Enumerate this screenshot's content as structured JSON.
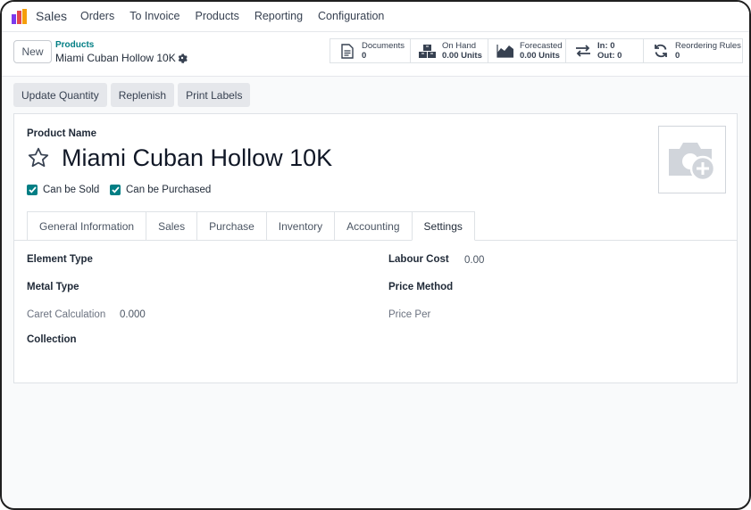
{
  "app": {
    "name": "Sales"
  },
  "menu": [
    {
      "label": "Orders"
    },
    {
      "label": "To Invoice"
    },
    {
      "label": "Products"
    },
    {
      "label": "Reporting"
    },
    {
      "label": "Configuration"
    }
  ],
  "control": {
    "new_label": "New",
    "breadcrumb_parent": "Products",
    "breadcrumb_current": "Miami Cuban Hollow 10K"
  },
  "smart_buttons": {
    "documents": {
      "label": "Documents",
      "value": "0",
      "icon": "document-icon"
    },
    "on_hand": {
      "label": "On Hand",
      "value": "0.00 Units",
      "icon": "boxes-icon"
    },
    "forecasted": {
      "label": "Forecasted",
      "value": "0.00 Units",
      "icon": "area-chart-icon"
    },
    "in_out": {
      "in_label": "In: 0",
      "out_label": "Out: 0",
      "icon": "transfer-arrows-icon"
    },
    "reordering": {
      "label": "Reordering Rules",
      "value": "0",
      "icon": "refresh-icon"
    }
  },
  "actions": {
    "update_quantity": "Update Quantity",
    "replenish": "Replenish",
    "print_labels": "Print Labels"
  },
  "form": {
    "product_name_label": "Product Name",
    "product_name": "Miami Cuban Hollow 10K",
    "can_be_sold": {
      "label": "Can be Sold",
      "checked": true
    },
    "can_be_purchased": {
      "label": "Can be Purchased",
      "checked": true
    }
  },
  "tabs": [
    {
      "label": "General Information"
    },
    {
      "label": "Sales"
    },
    {
      "label": "Purchase"
    },
    {
      "label": "Inventory"
    },
    {
      "label": "Accounting"
    },
    {
      "label": "Settings",
      "active": true
    }
  ],
  "settings": {
    "element_type": {
      "label": "Element Type",
      "value": ""
    },
    "metal_type": {
      "label": "Metal Type",
      "value": ""
    },
    "caret_calculation": {
      "label": "Caret Calculation",
      "value": "0.000"
    },
    "collection": {
      "label": "Collection",
      "value": ""
    },
    "labour_cost": {
      "label": "Labour Cost",
      "value": "0.00"
    },
    "price_method": {
      "label": "Price Method",
      "value": ""
    },
    "price_per": {
      "label": "Price Per",
      "value": ""
    }
  },
  "colors": {
    "accent": "#017e84",
    "logo_red": "#e5484d",
    "logo_orange": "#f59e0b",
    "logo_purple": "#7c3aed"
  }
}
